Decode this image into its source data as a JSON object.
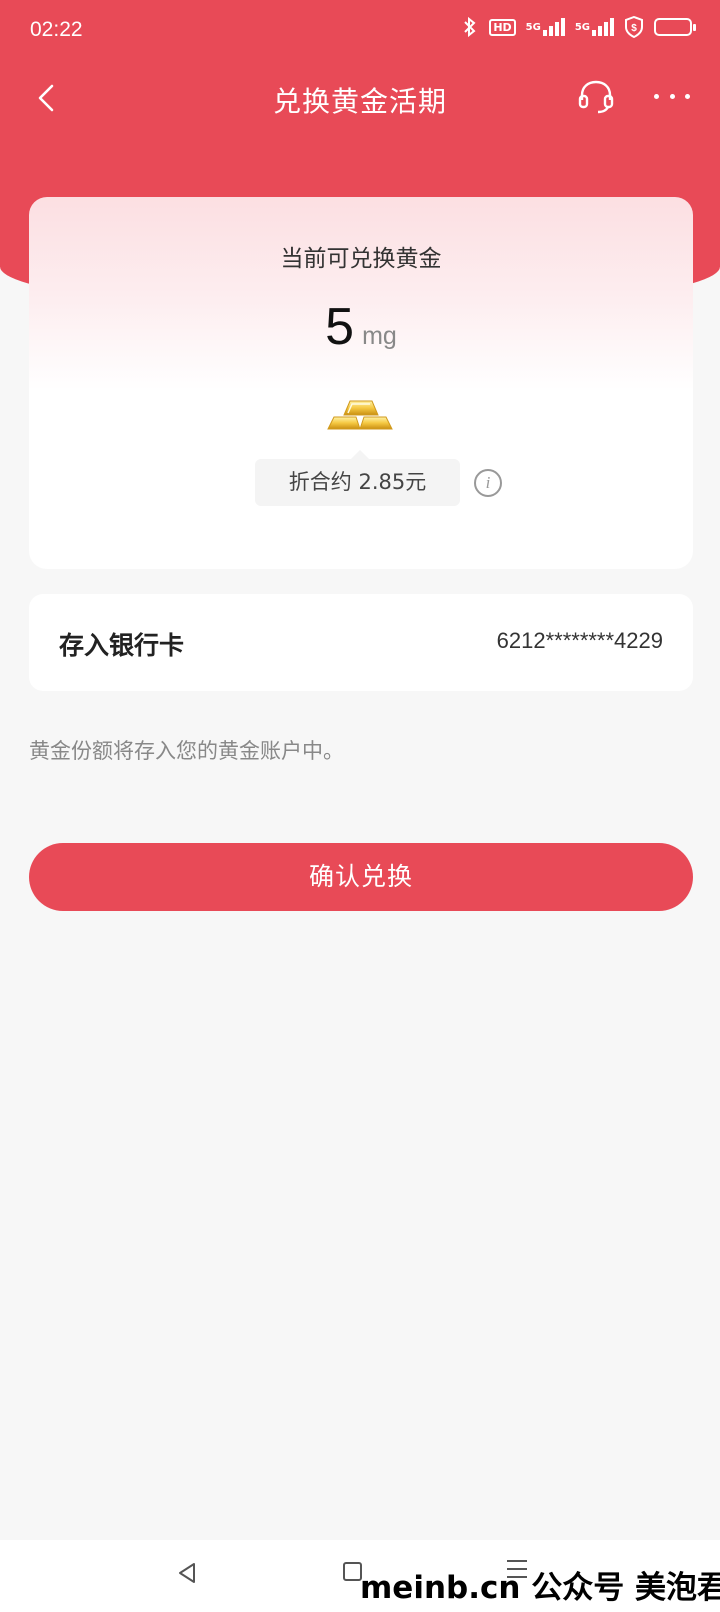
{
  "status_bar": {
    "time": "02:22",
    "icons": [
      "bluetooth-icon",
      "hd-icon",
      "signal-5g-icon",
      "signal-5g-icon",
      "shield-icon",
      "battery-icon"
    ],
    "hd_label": "HD",
    "fiveg_1": "5G",
    "fiveg_2": "5G"
  },
  "header": {
    "title": "兑换黄金活期",
    "back_icon": "chevron-left-icon",
    "service_icon": "headset-icon",
    "more_icon": "more-dots-icon"
  },
  "gold_card": {
    "label": "当前可兑换黄金",
    "amount": "5",
    "unit": "mg",
    "equivalent": "折合约 2.85元",
    "info_icon_glyph": "i"
  },
  "bank": {
    "label": "存入银行卡",
    "card_number": "6212********4229"
  },
  "note": "黄金份额将存入您的黄金账户中。",
  "confirm_button": "确认兑换",
  "watermark": "meinb.cn 公众号 美泡君",
  "colors": {
    "accent": "#e84a57",
    "background": "#f7f7f7"
  }
}
